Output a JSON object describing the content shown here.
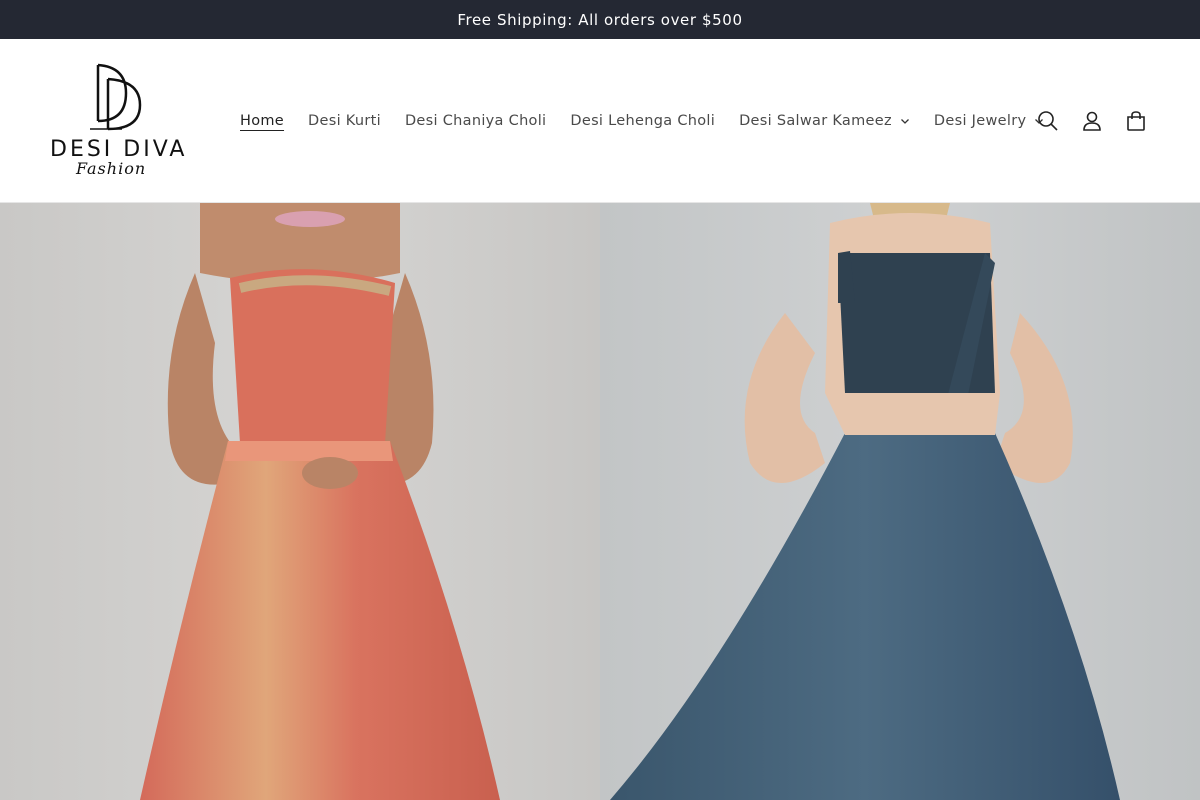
{
  "announcement": {
    "text": "Free Shipping: All orders over $500"
  },
  "brand": {
    "monogram": "DD",
    "name": "DESI DIVA",
    "tagline": "Fashion"
  },
  "nav": {
    "items": [
      {
        "label": "Home",
        "active": true,
        "dropdown": false
      },
      {
        "label": "Desi Kurti",
        "active": false,
        "dropdown": false
      },
      {
        "label": "Desi Chaniya Choli",
        "active": false,
        "dropdown": false
      },
      {
        "label": "Desi Lehenga Choli",
        "active": false,
        "dropdown": false
      },
      {
        "label": "Desi Salwar Kameez",
        "active": false,
        "dropdown": true
      },
      {
        "label": "Desi Jewelry",
        "active": false,
        "dropdown": true
      }
    ]
  },
  "header_icons": [
    "search-icon",
    "account-icon",
    "cart-icon"
  ],
  "hero": {
    "slides": [
      {
        "icon": "photo-model-coral-lehenga",
        "dress_color": "#d9735f"
      },
      {
        "icon": "photo-model-blue-lehenga",
        "dress_color": "#3f5b73"
      }
    ]
  },
  "colors": {
    "announcement_bg": "#242833",
    "text": "#222222",
    "nav_text": "#4a4a4a"
  }
}
